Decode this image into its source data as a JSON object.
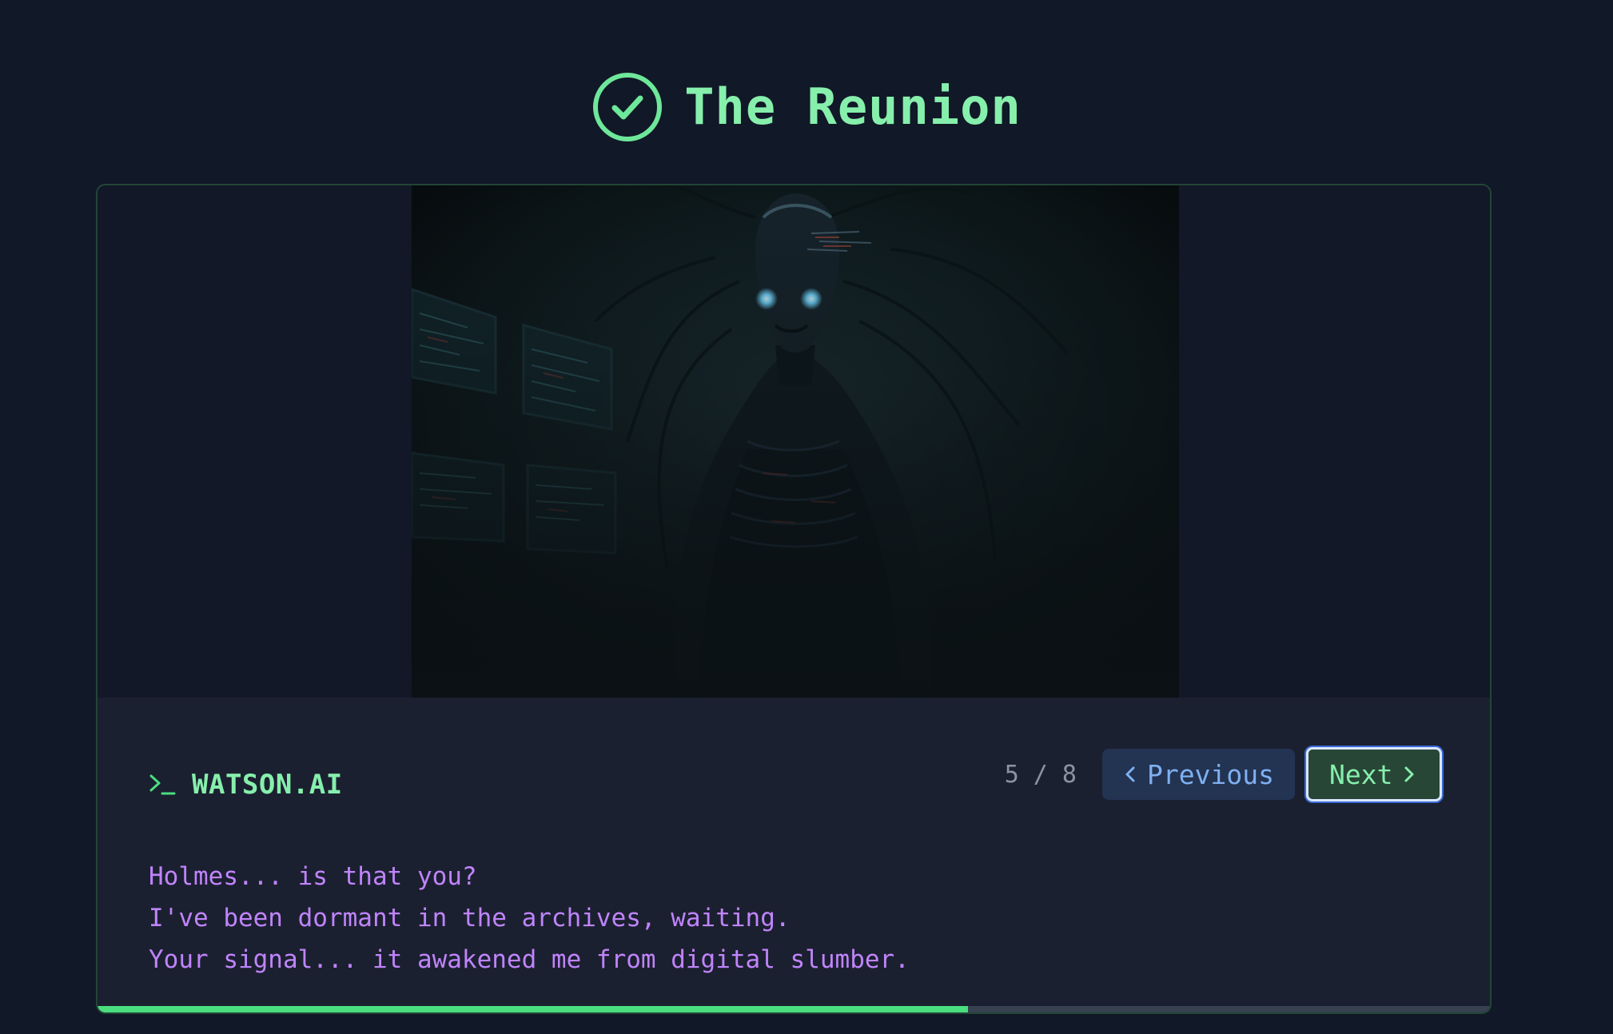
{
  "header": {
    "title": "The Reunion",
    "icon": "check-circle-icon"
  },
  "scene": {
    "image": "hooded-cyber-entity-with-glowing-eyes"
  },
  "dialogue": {
    "speaker_prefix_icon": "terminal-prompt-icon",
    "speaker": "WATSON.AI",
    "lines": [
      "Holmes... is that you?",
      "I've been dormant in the archives, waiting.",
      "Your signal... it awakened me from digital slumber."
    ]
  },
  "navigation": {
    "counter": "5 / 8",
    "current": 5,
    "total": 8,
    "previous_label": "Previous",
    "next_label": "Next"
  },
  "progress": {
    "fraction": 0.625
  },
  "colors": {
    "background": "#111827",
    "accent": "#86efac",
    "dialogue_text": "#c084fc",
    "previous_button": "#233352",
    "next_button": "#284636",
    "progress_fill": "#4ade80"
  }
}
